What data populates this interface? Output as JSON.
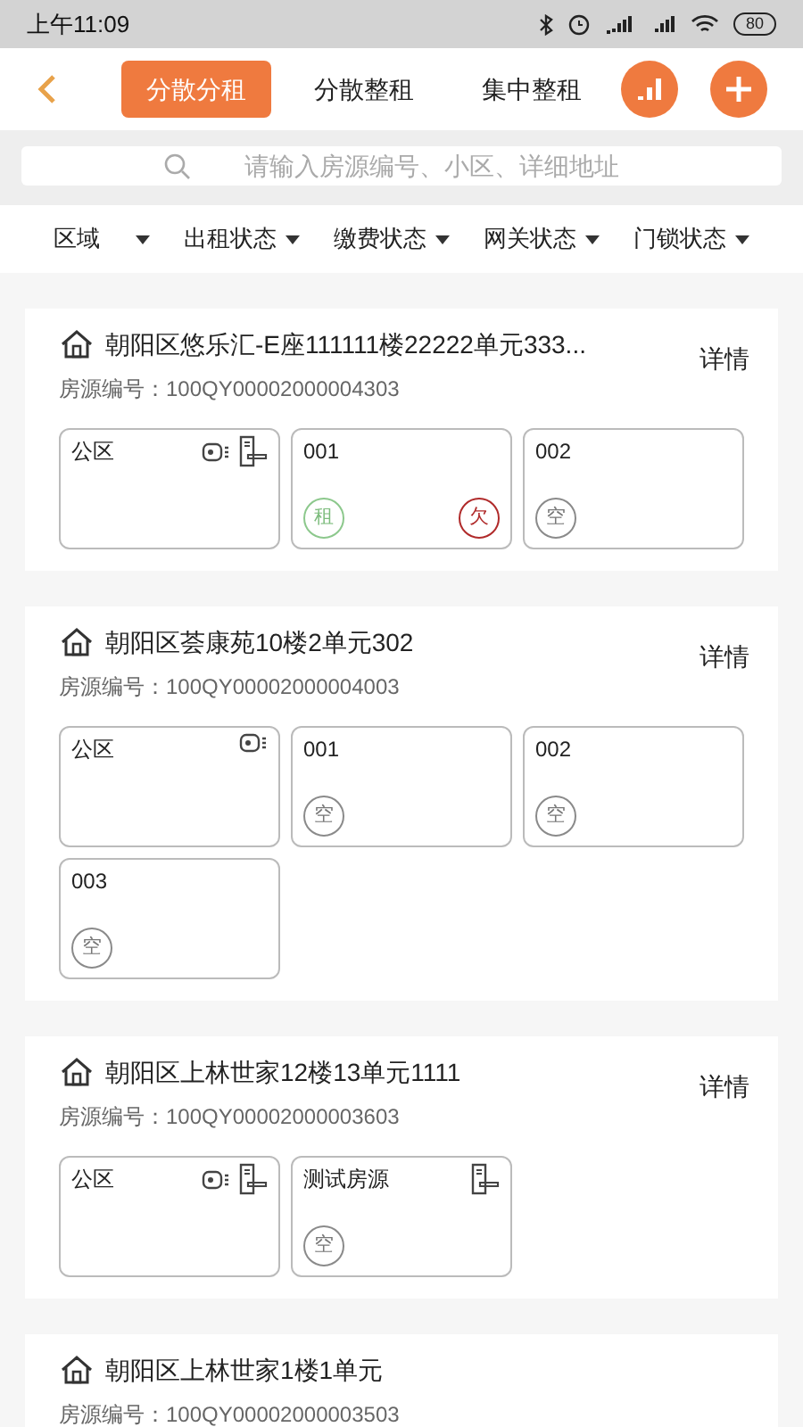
{
  "status_bar": {
    "time": "上午11:09",
    "battery": "80"
  },
  "header": {
    "tabs": [
      {
        "label": "分散分租",
        "selected": true
      },
      {
        "label": "分散整租",
        "selected": false
      },
      {
        "label": "集中整租",
        "selected": false
      }
    ]
  },
  "search": {
    "placeholder": "请输入房源编号、小区、详细地址"
  },
  "filters": [
    {
      "label": "区域"
    },
    {
      "label": "出租状态"
    },
    {
      "label": "缴费状态"
    },
    {
      "label": "网关状态"
    },
    {
      "label": "门锁状态"
    }
  ],
  "properties": [
    {
      "address": "朝阳区悠乐汇-E座111111楼22222单元333...",
      "code_label": "房源编号：",
      "code": "100QY00002000004303",
      "detail": "详情",
      "units": [
        {
          "name": "公区",
          "gateway": true,
          "lock": true
        },
        {
          "name": "001",
          "gateway": false,
          "lock": false,
          "tags": [
            {
              "kind": "rent",
              "text": "租"
            },
            {
              "kind": "owe",
              "text": "欠"
            }
          ]
        },
        {
          "name": "002",
          "gateway": false,
          "lock": false,
          "tags": [
            {
              "kind": "empty",
              "text": "空"
            }
          ]
        }
      ]
    },
    {
      "address": "朝阳区荟康苑10楼2单元302",
      "code_label": "房源编号：",
      "code": "100QY00002000004003",
      "detail": "详情",
      "units": [
        {
          "name": "公区",
          "gateway": true,
          "lock": false
        },
        {
          "name": "001",
          "gateway": false,
          "lock": false,
          "tags": [
            {
              "kind": "empty",
              "text": "空"
            }
          ]
        },
        {
          "name": "002",
          "gateway": false,
          "lock": false,
          "tags": [
            {
              "kind": "empty",
              "text": "空"
            }
          ]
        },
        {
          "name": "003",
          "gateway": false,
          "lock": false,
          "tags": [
            {
              "kind": "empty",
              "text": "空"
            }
          ]
        }
      ]
    },
    {
      "address": "朝阳区上林世家12楼13单元1111",
      "code_label": "房源编号：",
      "code": "100QY00002000003603",
      "detail": "详情",
      "units": [
        {
          "name": "公区",
          "gateway": true,
          "lock": true
        },
        {
          "name": "测试房源",
          "gateway": false,
          "lock": true,
          "tags": [
            {
              "kind": "empty",
              "text": "空"
            }
          ]
        }
      ]
    },
    {
      "address": "朝阳区上林世家1楼1单元",
      "code_label": "房源编号：",
      "code": "100QY00002000003503"
    }
  ]
}
